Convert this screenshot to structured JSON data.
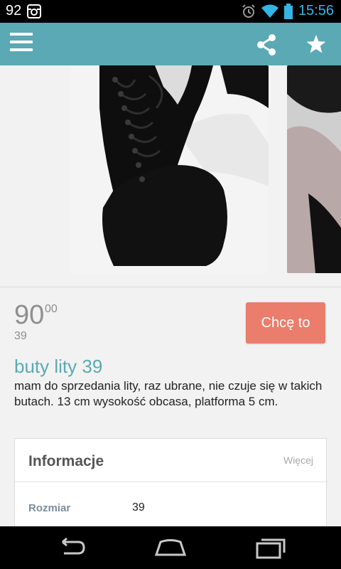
{
  "status_bar": {
    "notification_count": "92",
    "time": "15:56",
    "icons": [
      "instagram-icon",
      "alarm-icon",
      "wifi-icon",
      "battery-icon"
    ]
  },
  "app_bar": {
    "color": "#5aa9b4",
    "icons": [
      "menu-icon",
      "share-icon",
      "star-icon"
    ]
  },
  "listing": {
    "price_main": "90",
    "price_cents": "00",
    "size_subtitle": "39",
    "cta_label": "Chcę to",
    "cta_color": "#ea7d6c",
    "title": "buty lity 39",
    "description": "mam do sprzedania lity, raz ubrane, nie czuje się w takich butach. 13 cm wysokość obcasa, platforma 5 cm."
  },
  "info_card": {
    "title": "Informacje",
    "more_label": "Więcej",
    "rows": [
      {
        "label": "Rozmiar",
        "value": "39"
      }
    ]
  },
  "nav_bar": {
    "icons": [
      "back-icon",
      "home-icon",
      "recent-apps-icon"
    ]
  }
}
